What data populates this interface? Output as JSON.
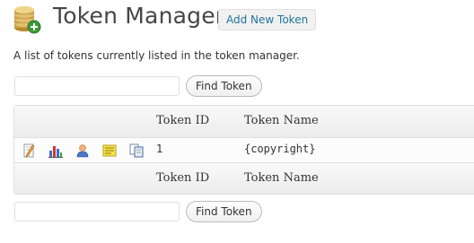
{
  "header": {
    "title": "Token Manager",
    "add_new_label": "Add New Token",
    "logo_icon": "coins-add-icon"
  },
  "description": "A list of tokens currently listed in the token manager.",
  "search_top": {
    "value": "",
    "placeholder": "",
    "button_label": "Find Token"
  },
  "search_bottom": {
    "value": "",
    "placeholder": "",
    "button_label": "Find Token"
  },
  "table": {
    "columns": [
      "Token ID",
      "Token Name"
    ],
    "row_action_icons": [
      "edit-icon",
      "stats-icon",
      "user-icon",
      "note-icon",
      "copy-icon"
    ],
    "rows": [
      {
        "id": "1",
        "name": "{copyright}"
      }
    ]
  },
  "colors": {
    "link": "#21759b",
    "header_gradient_top": "#f9f9f9",
    "header_gradient_bottom": "#ececec",
    "border": "#dfdfdf"
  }
}
